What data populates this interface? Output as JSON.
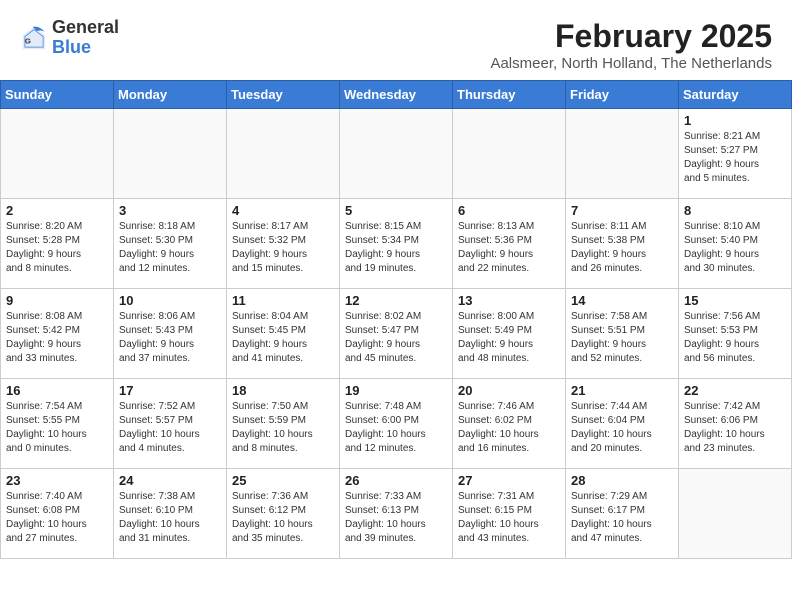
{
  "header": {
    "logo_general": "General",
    "logo_blue": "Blue",
    "month_year": "February 2025",
    "location": "Aalsmeer, North Holland, The Netherlands"
  },
  "days_of_week": [
    "Sunday",
    "Monday",
    "Tuesday",
    "Wednesday",
    "Thursday",
    "Friday",
    "Saturday"
  ],
  "weeks": [
    [
      {
        "num": "",
        "info": ""
      },
      {
        "num": "",
        "info": ""
      },
      {
        "num": "",
        "info": ""
      },
      {
        "num": "",
        "info": ""
      },
      {
        "num": "",
        "info": ""
      },
      {
        "num": "",
        "info": ""
      },
      {
        "num": "1",
        "info": "Sunrise: 8:21 AM\nSunset: 5:27 PM\nDaylight: 9 hours\nand 5 minutes."
      }
    ],
    [
      {
        "num": "2",
        "info": "Sunrise: 8:20 AM\nSunset: 5:28 PM\nDaylight: 9 hours\nand 8 minutes."
      },
      {
        "num": "3",
        "info": "Sunrise: 8:18 AM\nSunset: 5:30 PM\nDaylight: 9 hours\nand 12 minutes."
      },
      {
        "num": "4",
        "info": "Sunrise: 8:17 AM\nSunset: 5:32 PM\nDaylight: 9 hours\nand 15 minutes."
      },
      {
        "num": "5",
        "info": "Sunrise: 8:15 AM\nSunset: 5:34 PM\nDaylight: 9 hours\nand 19 minutes."
      },
      {
        "num": "6",
        "info": "Sunrise: 8:13 AM\nSunset: 5:36 PM\nDaylight: 9 hours\nand 22 minutes."
      },
      {
        "num": "7",
        "info": "Sunrise: 8:11 AM\nSunset: 5:38 PM\nDaylight: 9 hours\nand 26 minutes."
      },
      {
        "num": "8",
        "info": "Sunrise: 8:10 AM\nSunset: 5:40 PM\nDaylight: 9 hours\nand 30 minutes."
      }
    ],
    [
      {
        "num": "9",
        "info": "Sunrise: 8:08 AM\nSunset: 5:42 PM\nDaylight: 9 hours\nand 33 minutes."
      },
      {
        "num": "10",
        "info": "Sunrise: 8:06 AM\nSunset: 5:43 PM\nDaylight: 9 hours\nand 37 minutes."
      },
      {
        "num": "11",
        "info": "Sunrise: 8:04 AM\nSunset: 5:45 PM\nDaylight: 9 hours\nand 41 minutes."
      },
      {
        "num": "12",
        "info": "Sunrise: 8:02 AM\nSunset: 5:47 PM\nDaylight: 9 hours\nand 45 minutes."
      },
      {
        "num": "13",
        "info": "Sunrise: 8:00 AM\nSunset: 5:49 PM\nDaylight: 9 hours\nand 48 minutes."
      },
      {
        "num": "14",
        "info": "Sunrise: 7:58 AM\nSunset: 5:51 PM\nDaylight: 9 hours\nand 52 minutes."
      },
      {
        "num": "15",
        "info": "Sunrise: 7:56 AM\nSunset: 5:53 PM\nDaylight: 9 hours\nand 56 minutes."
      }
    ],
    [
      {
        "num": "16",
        "info": "Sunrise: 7:54 AM\nSunset: 5:55 PM\nDaylight: 10 hours\nand 0 minutes."
      },
      {
        "num": "17",
        "info": "Sunrise: 7:52 AM\nSunset: 5:57 PM\nDaylight: 10 hours\nand 4 minutes."
      },
      {
        "num": "18",
        "info": "Sunrise: 7:50 AM\nSunset: 5:59 PM\nDaylight: 10 hours\nand 8 minutes."
      },
      {
        "num": "19",
        "info": "Sunrise: 7:48 AM\nSunset: 6:00 PM\nDaylight: 10 hours\nand 12 minutes."
      },
      {
        "num": "20",
        "info": "Sunrise: 7:46 AM\nSunset: 6:02 PM\nDaylight: 10 hours\nand 16 minutes."
      },
      {
        "num": "21",
        "info": "Sunrise: 7:44 AM\nSunset: 6:04 PM\nDaylight: 10 hours\nand 20 minutes."
      },
      {
        "num": "22",
        "info": "Sunrise: 7:42 AM\nSunset: 6:06 PM\nDaylight: 10 hours\nand 23 minutes."
      }
    ],
    [
      {
        "num": "23",
        "info": "Sunrise: 7:40 AM\nSunset: 6:08 PM\nDaylight: 10 hours\nand 27 minutes."
      },
      {
        "num": "24",
        "info": "Sunrise: 7:38 AM\nSunset: 6:10 PM\nDaylight: 10 hours\nand 31 minutes."
      },
      {
        "num": "25",
        "info": "Sunrise: 7:36 AM\nSunset: 6:12 PM\nDaylight: 10 hours\nand 35 minutes."
      },
      {
        "num": "26",
        "info": "Sunrise: 7:33 AM\nSunset: 6:13 PM\nDaylight: 10 hours\nand 39 minutes."
      },
      {
        "num": "27",
        "info": "Sunrise: 7:31 AM\nSunset: 6:15 PM\nDaylight: 10 hours\nand 43 minutes."
      },
      {
        "num": "28",
        "info": "Sunrise: 7:29 AM\nSunset: 6:17 PM\nDaylight: 10 hours\nand 47 minutes."
      },
      {
        "num": "",
        "info": ""
      }
    ]
  ]
}
